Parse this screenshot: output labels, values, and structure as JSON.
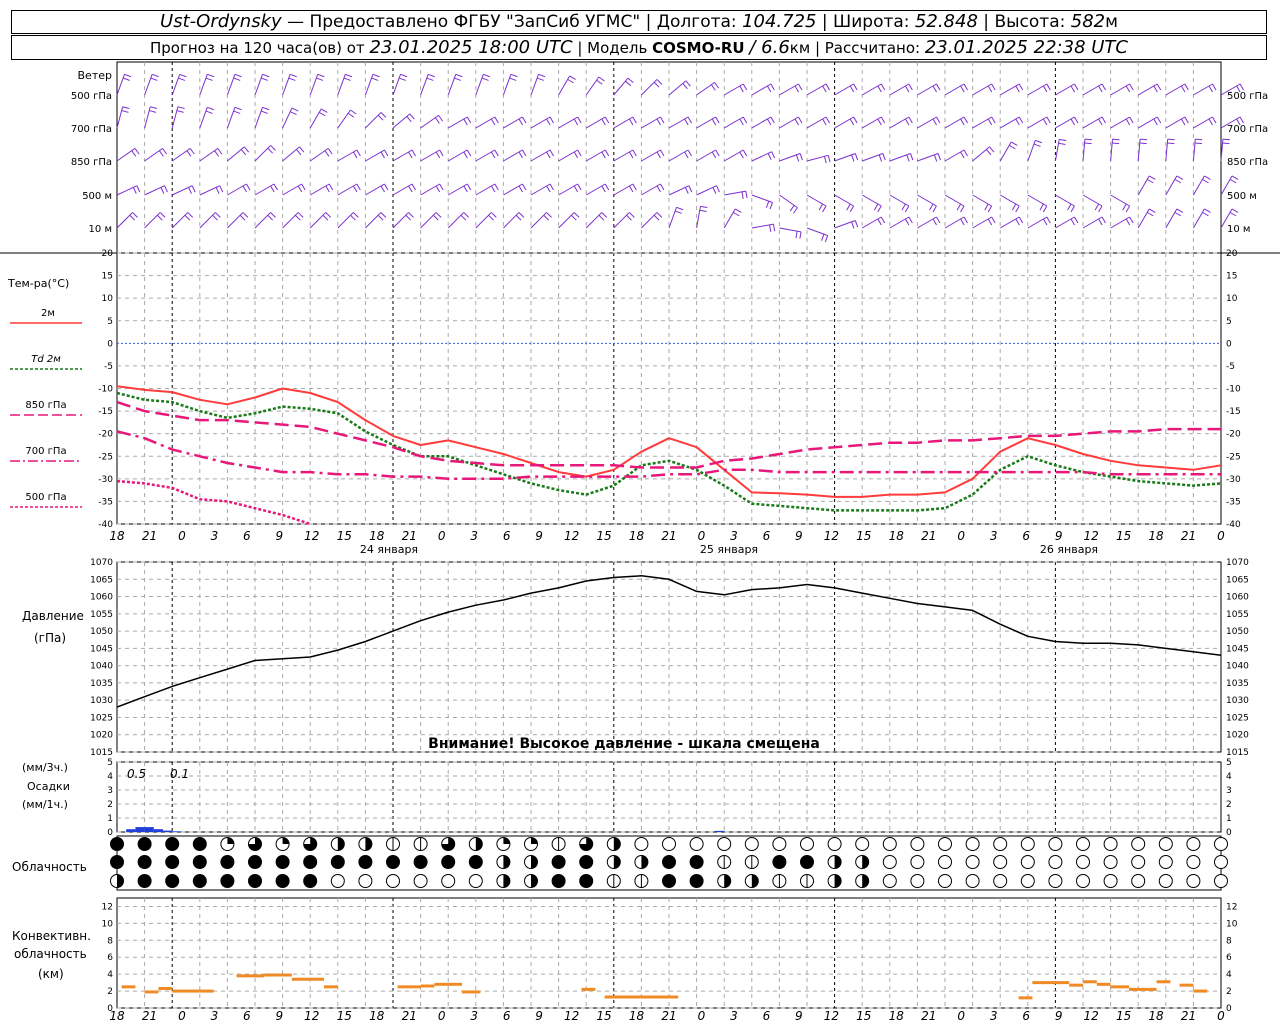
{
  "header": {
    "station": "Ust-Ordynsky",
    "provider": "— Предоставлено ФГБУ \"ЗапСиб УГМС\"",
    "lon_label": "Долгота:",
    "lon": "104.725",
    "lat_label": "Широта:",
    "lat": "52.848",
    "alt_label": "Высота:",
    "alt": "582",
    "alt_unit": "м",
    "forecast_label": "Прогноз на 120 часа(ов) от",
    "forecast_time": "23.01.2025 18:00 UTC",
    "model_label": "Модель",
    "model": "COSMO-RU",
    "model_res": "/ 6.6",
    "model_res_unit": "км",
    "calc_label": "Рассчитано:",
    "calc_time": "23.01.2025 22:38 UTC"
  },
  "colors": {
    "t2m": "#ff3b3b",
    "td2m": "#1a7a1a",
    "t850": "#e8177a",
    "t700": "#e8177a",
    "t500": "#e8177a",
    "wind": "#7b2fd0",
    "precip": "#1f3fd8",
    "conv": "#f08a24",
    "zero": "#3a5fe0"
  },
  "wind_panel": {
    "title": "Ветер",
    "levels": [
      "500 гПа",
      "700 гПа",
      "850 гПа",
      "500 м",
      "10 м"
    ]
  },
  "temp_panel": {
    "title": "Тем-ра(°C)",
    "legend": [
      "2м",
      "Td  2м",
      "850 гПа",
      "700 гПа",
      "500 гПа"
    ]
  },
  "pressure_panel": {
    "title1": "Давление",
    "title2": "(гПа)",
    "warning": "Внимание! Высокое давление - шкала смещена"
  },
  "precip_panel": {
    "unit3": "(мм/3ч.)",
    "title": "Осадки",
    "unit1": "(мм/1ч.)",
    "annot1": "0.5",
    "annot2": "0.1"
  },
  "cloud_panel": {
    "title": "Облачность"
  },
  "conv_panel": {
    "title1": "Конвективн.",
    "title2": "облачность",
    "title3": "(км)"
  },
  "chart_data": [
    {
      "type": "line",
      "title": "Тем-ра(°C)",
      "x_hours": [
        0,
        3,
        6,
        9,
        12,
        15,
        18,
        21,
        24,
        27,
        30,
        33,
        36,
        39,
        42,
        45,
        48,
        51,
        54,
        57,
        60,
        63,
        66,
        69,
        72,
        75,
        78,
        81,
        84,
        87,
        90,
        93,
        96,
        99,
        102,
        105,
        108,
        111,
        114,
        117,
        120
      ],
      "x_tick_labels": [
        "18",
        "21",
        "0",
        "3",
        "6",
        "9",
        "12",
        "15",
        "18",
        "21",
        "0",
        "3",
        "6",
        "9",
        "12",
        "15",
        "18",
        "21",
        "0",
        "3",
        "6",
        "9",
        "12",
        "15",
        "18",
        "21",
        "0",
        "3",
        "6",
        "9",
        "12",
        "15",
        "18",
        "21",
        "0"
      ],
      "date_labels": [
        "24 января",
        "25 января",
        "26 января"
      ],
      "yticks": [
        20,
        15,
        10,
        5,
        0,
        -5,
        -10,
        -15,
        -20,
        -25,
        -30,
        -35,
        -40
      ],
      "ylim": [
        -40,
        20
      ],
      "series": [
        {
          "name": "2м",
          "key": "t2m",
          "values": [
            -9.5,
            -10.3,
            -10.8,
            -12.5,
            -13.5,
            -12.0,
            -10.0,
            -11.0,
            -13.0,
            -17.0,
            -20.5,
            -22.5,
            -21.5,
            -23.0,
            -24.5,
            -26.5,
            -28.5,
            -29.5,
            -28.0,
            -24.0,
            -21.0,
            -23.0,
            -28.0,
            -33.0,
            -33.2,
            -33.5,
            -34.0,
            -34.0,
            -33.5,
            -33.5,
            -33.0,
            -30.0,
            -24.0,
            -21.0,
            -22.5,
            -24.5,
            -26.0,
            -27.0,
            -27.5,
            -28.0,
            -27.0
          ]
        },
        {
          "name": "Td 2м",
          "key": "td2m",
          "values": [
            -11.0,
            -12.5,
            -13.0,
            -15.0,
            -16.5,
            -15.5,
            -14.0,
            -14.5,
            -15.5,
            -19.5,
            -22.5,
            -25.0,
            -25.0,
            -27.0,
            -29.0,
            -31.0,
            -32.5,
            -33.5,
            -31.5,
            -27.0,
            -26.0,
            -28.0,
            -31.5,
            -35.5,
            -36.0,
            -36.5,
            -37.0,
            -37.0,
            -37.0,
            -37.0,
            -36.5,
            -33.5,
            -28.0,
            -25.0,
            -27.0,
            -28.5,
            -29.5,
            -30.5,
            -31.0,
            -31.5,
            -31.0
          ]
        },
        {
          "name": "850 гПа",
          "key": "t850",
          "values": [
            -13.0,
            -15.0,
            -16.0,
            -17.0,
            -17.0,
            -17.5,
            -18.0,
            -18.5,
            -20.0,
            -21.5,
            -23.0,
            -25.0,
            -26.0,
            -26.5,
            -27.0,
            -27.0,
            -27.0,
            -27.0,
            -27.0,
            -27.5,
            -27.5,
            -27.5,
            -26.0,
            -25.5,
            -24.5,
            -23.5,
            -23.0,
            -22.5,
            -22.0,
            -22.0,
            -21.5,
            -21.5,
            -21.0,
            -20.5,
            -20.5,
            -20.0,
            -19.5,
            -19.5,
            -19.0,
            -19.0,
            -19.0
          ]
        },
        {
          "name": "700 гПа",
          "key": "t700",
          "values": [
            -19.5,
            -21.0,
            -23.5,
            -25.0,
            -26.5,
            -27.5,
            -28.5,
            -28.5,
            -29.0,
            -29.0,
            -29.5,
            -29.5,
            -30.0,
            -30.0,
            -30.0,
            -29.5,
            -29.5,
            -29.5,
            -29.5,
            -29.5,
            -29.0,
            -29.0,
            -28.0,
            -28.0,
            -28.5,
            -28.5,
            -28.5,
            -28.5,
            -28.5,
            -28.5,
            -28.5,
            -28.5,
            -28.5,
            -28.5,
            -28.5,
            -28.5,
            -29.0,
            -29.0,
            -29.0,
            -29.0,
            -29.0
          ]
        },
        {
          "name": "500 гПа",
          "key": "t500",
          "values": [
            -30.5,
            -31.0,
            -32.0,
            -34.5,
            -35.0,
            -36.5,
            -38.0,
            -40.0
          ]
        }
      ]
    },
    {
      "type": "line",
      "title": "Давление",
      "ylabel": "(гПа)",
      "yticks": [
        1070,
        1065,
        1060,
        1055,
        1050,
        1045,
        1040,
        1035,
        1030,
        1025,
        1020,
        1015
      ],
      "ylim": [
        1015,
        1070
      ],
      "x_hours": [
        0,
        3,
        6,
        9,
        12,
        15,
        18,
        21,
        24,
        27,
        30,
        33,
        36,
        39,
        42,
        45,
        48,
        51,
        54,
        57,
        60,
        63,
        66,
        69,
        72,
        75,
        78,
        81,
        84,
        87,
        90,
        93,
        96,
        99,
        102,
        105,
        108,
        111,
        114,
        117,
        120
      ],
      "series": [
        {
          "name": "Давление",
          "values": [
            1028,
            1031,
            1034,
            1036.5,
            1039,
            1041.5,
            1042,
            1042.5,
            1044.5,
            1047,
            1050,
            1053,
            1055.5,
            1057.5,
            1059,
            1061,
            1062.5,
            1064.5,
            1065.5,
            1066,
            1065,
            1061.5,
            1060.5,
            1062,
            1062.5,
            1063.5,
            1062.5,
            1061,
            1059.5,
            1058,
            1057,
            1056,
            1052,
            1048.5,
            1047,
            1046.5,
            1046.5,
            1046,
            1045,
            1044,
            1043
          ]
        }
      ]
    },
    {
      "type": "bar",
      "title": "Осадки",
      "yticks": [
        5,
        4,
        3,
        2,
        1,
        0
      ],
      "ylim": [
        0,
        5
      ],
      "bars": [
        {
          "hour": 1.5,
          "value": 0.2
        },
        {
          "hour": 2.5,
          "value": 0.35
        },
        {
          "hour": 3.5,
          "value": 0.35
        },
        {
          "hour": 4.5,
          "value": 0.2
        },
        {
          "hour": 5.5,
          "value": 0.1
        },
        {
          "hour": 6.5,
          "value": 0.05
        },
        {
          "hour": 65.5,
          "value": 0.08
        }
      ]
    },
    {
      "type": "bar",
      "title": "Конвективн. облачность",
      "ylabel": "(км)",
      "yticks": [
        12,
        10,
        8,
        6,
        4,
        2,
        0
      ],
      "ylim": [
        0,
        13
      ],
      "segments": [
        {
          "h0": 0.5,
          "h1": 2,
          "value": 2.5
        },
        {
          "h0": 3,
          "h1": 4.5,
          "value": 1.9
        },
        {
          "h0": 4.5,
          "h1": 6,
          "value": 2.3
        },
        {
          "h0": 6,
          "h1": 7.5,
          "value": 2.0
        },
        {
          "h0": 7.5,
          "h1": 9,
          "value": 2.0
        },
        {
          "h0": 9,
          "h1": 10.5,
          "value": 2.0
        },
        {
          "h0": 13,
          "h1": 16,
          "value": 3.8
        },
        {
          "h0": 16,
          "h1": 19,
          "value": 3.9
        },
        {
          "h0": 19,
          "h1": 21,
          "value": 3.4
        },
        {
          "h0": 21,
          "h1": 22.5,
          "value": 3.4
        },
        {
          "h0": 22.5,
          "h1": 24,
          "value": 2.5
        },
        {
          "h0": 30.5,
          "h1": 33,
          "value": 2.5
        },
        {
          "h0": 33,
          "h1": 34.5,
          "value": 2.6
        },
        {
          "h0": 34.5,
          "h1": 37.5,
          "value": 2.8
        },
        {
          "h0": 37.5,
          "h1": 39.5,
          "value": 1.9
        },
        {
          "h0": 50.5,
          "h1": 52,
          "value": 2.2
        },
        {
          "h0": 53,
          "h1": 61,
          "value": 1.3
        },
        {
          "h0": 98,
          "h1": 99.5,
          "value": 1.2
        },
        {
          "h0": 99.5,
          "h1": 103.5,
          "value": 3.0
        },
        {
          "h0": 103.5,
          "h1": 105,
          "value": 2.7
        },
        {
          "h0": 105,
          "h1": 106.5,
          "value": 3.1
        },
        {
          "h0": 106.5,
          "h1": 108,
          "value": 2.8
        },
        {
          "h0": 108,
          "h1": 110,
          "value": 2.5
        },
        {
          "h0": 110,
          "h1": 113,
          "value": 2.2
        },
        {
          "h0": 113,
          "h1": 114.5,
          "value": 3.1
        },
        {
          "h0": 115.5,
          "h1": 117,
          "value": 2.7
        },
        {
          "h0": 117,
          "h1": 118.5,
          "value": 2.0
        }
      ]
    },
    {
      "type": "table",
      "title": "Облачность",
      "rows": [
        "ffff43432211324413200000000000000000000000000000000000000000000000000000000000000000000000000000000000000000000000000000",
        "ffffffffffffff22ff22ff11ff22000000000000000000000000000000000000000000000000000000000000000000000000000000000000000000",
        "2fffffff00000022ff11ff22112200000000000000000000000000000000000000000000000000000000000000000000000000000000000000000000"
      ]
    }
  ]
}
